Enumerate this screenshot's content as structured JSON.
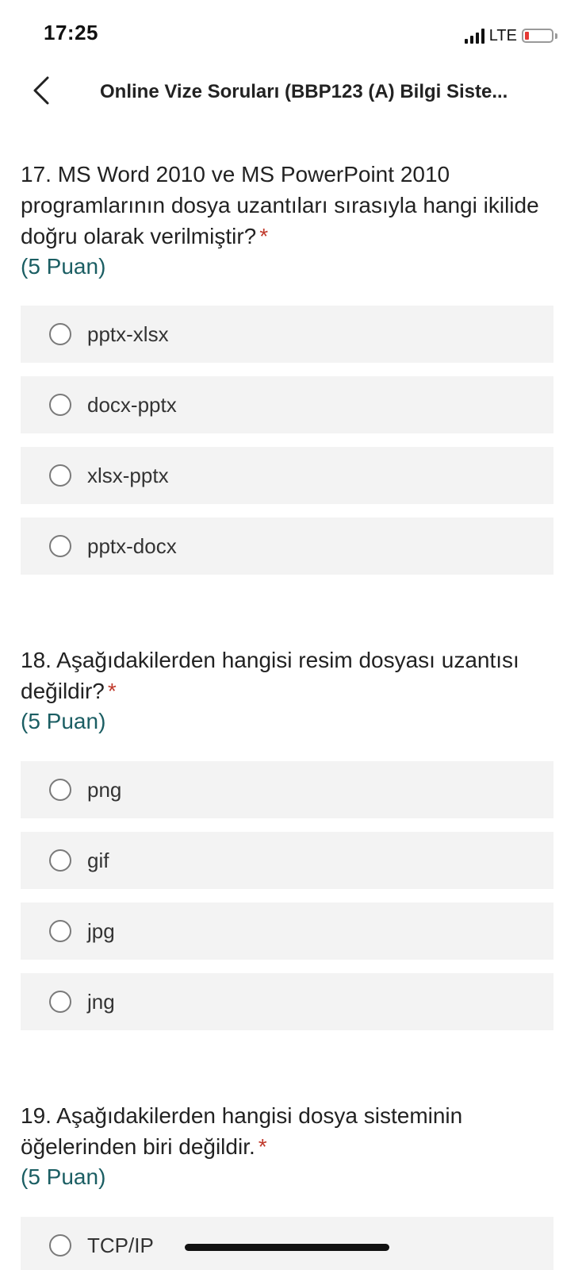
{
  "status_bar": {
    "time": "17:25",
    "network": "LTE",
    "battery_color": "#e53935"
  },
  "nav": {
    "back_icon": "chevron-left-icon",
    "title": "Online Vize Soruları (BBP123 (A) Bilgi Siste..."
  },
  "questions": [
    {
      "text": "17. MS Word 2010 ve MS PowerPoint 2010 programlarının dosya uzantıları sırasıyla hangi ikilide doğru olarak verilmiştir?",
      "required_mark": "*",
      "points": "(5 Puan)",
      "options": [
        "pptx-xlsx",
        "docx-pptx",
        "xlsx-pptx",
        "pptx-docx"
      ]
    },
    {
      "text": "18. Aşağıdakilerden hangisi resim dosyası uzantısı değildir?",
      "required_mark": "*",
      "points": "(5 Puan)",
      "options": [
        "png",
        "gif",
        "jpg",
        "jng"
      ]
    },
    {
      "text": "19. Aşağıdakilerden hangisi dosya sisteminin öğelerinden biri değildir.",
      "required_mark": "*",
      "points": "(5 Puan)",
      "options": [
        "TCP/IP"
      ]
    }
  ],
  "colors": {
    "accent_points": "#1b5e63",
    "required": "#c0392b",
    "option_bg": "#f3f3f3"
  }
}
